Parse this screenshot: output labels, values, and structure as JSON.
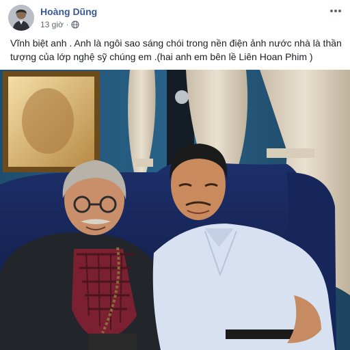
{
  "post": {
    "author": "Hoàng Dũng",
    "timestamp": "13 giờ",
    "privacy_icon": "globe-icon",
    "more_icon": "more-horizontal-icon",
    "text": "Vĩnh biệt anh . Anh là ngôi sao sáng chói trong nền điện ảnh nước nhà là thần tượng của lớp nghệ sỹ chúng em .(hai anh em bên lề Liên Hoan Phim )"
  },
  "colors": {
    "author_link": "#385898",
    "meta_text": "#616770",
    "body_text": "#1c1e21",
    "background": "#ffffff"
  }
}
